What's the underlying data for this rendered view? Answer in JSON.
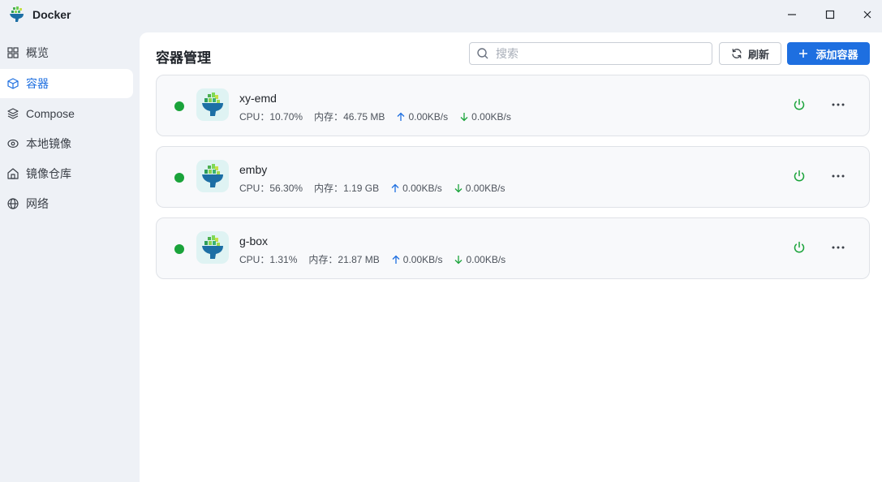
{
  "window": {
    "title": "Docker",
    "controls": [
      "minimize",
      "maximize",
      "close"
    ]
  },
  "sidebar": {
    "active_index": 1,
    "items": [
      {
        "label": "概览",
        "icon": "grid-icon"
      },
      {
        "label": "容器",
        "icon": "cube-icon"
      },
      {
        "label": "Compose",
        "icon": "layers-icon"
      },
      {
        "label": "本地镜像",
        "icon": "disk-icon"
      },
      {
        "label": "镜像仓库",
        "icon": "home-icon"
      },
      {
        "label": "网络",
        "icon": "globe-icon"
      }
    ]
  },
  "header": {
    "title": "容器管理",
    "search_placeholder": "搜索",
    "search_value": "",
    "refresh_label": "刷新",
    "add_label": "添加容器"
  },
  "containers": [
    {
      "name": "xy-emd",
      "status": "running",
      "cpu_label": "CPU：",
      "cpu": "10.70%",
      "mem_label": "内存：",
      "mem": "46.75 MB",
      "up": "0.00KB/s",
      "down": "0.00KB/s"
    },
    {
      "name": "emby",
      "status": "running",
      "cpu_label": "CPU：",
      "cpu": "56.30%",
      "mem_label": "内存：",
      "mem": "1.19 GB",
      "up": "0.00KB/s",
      "down": "0.00KB/s"
    },
    {
      "name": "g-box",
      "status": "running",
      "cpu_label": "CPU：",
      "cpu": "1.31%",
      "mem_label": "内存：",
      "mem": "21.87 MB",
      "up": "0.00KB/s",
      "down": "0.00KB/s"
    }
  ],
  "colors": {
    "accent": "#1e6fe0",
    "running": "#1aa33a",
    "upload_arrow": "#1e6fe0",
    "download_arrow": "#1aa33a"
  }
}
